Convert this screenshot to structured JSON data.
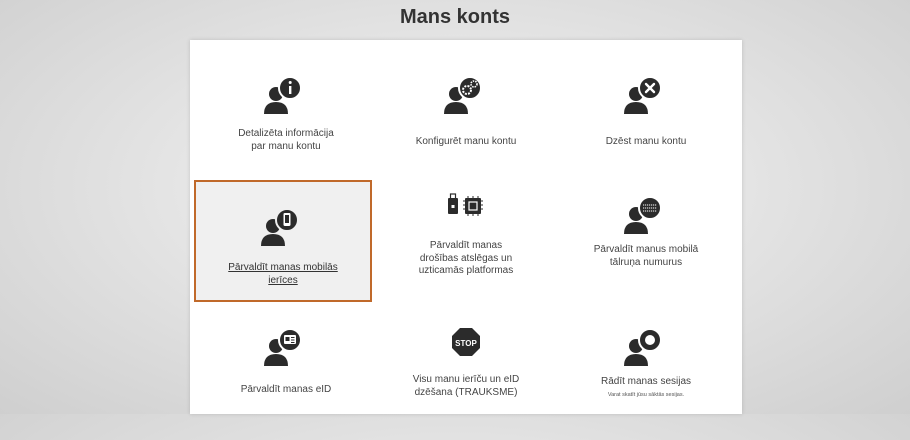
{
  "page": {
    "title": "Mans konts"
  },
  "tiles": [
    {
      "label": "Detalizēta informācija\npar manu kontu",
      "icon": "user-info-icon"
    },
    {
      "label": "Konfigurēt manu kontu",
      "icon": "user-settings-icon"
    },
    {
      "label": "Dzēst manu kontu",
      "icon": "user-delete-icon"
    },
    {
      "label": "Pārvaldīt manas mobilās\nierīces",
      "icon": "user-mobile-icon",
      "selected": true
    },
    {
      "label": "Pārvaldīt manas\ndrošības atslēgas un\nuzticamās platformas",
      "icon": "security-key-chip-icon"
    },
    {
      "label": "Pārvaldīt manus mobilā\ntālruņa numurus",
      "icon": "user-phone-number-icon"
    },
    {
      "label": "Pārvaldīt manas eID",
      "icon": "user-eid-card-icon"
    },
    {
      "label": "Visu manu ierīču un eID\ndzēšana (TRAUKSME)",
      "icon": "stop-sign-icon",
      "stop_text": "STOP"
    },
    {
      "label": "Rādīt manas sesijas",
      "sub": "Varat skatīt jūsu sāktās sesijas.",
      "icon": "user-sessions-icon"
    }
  ],
  "colors": {
    "icon": "#2b2b2b",
    "selected_border": "#c0692a",
    "selected_bg": "#f0f0f0"
  }
}
